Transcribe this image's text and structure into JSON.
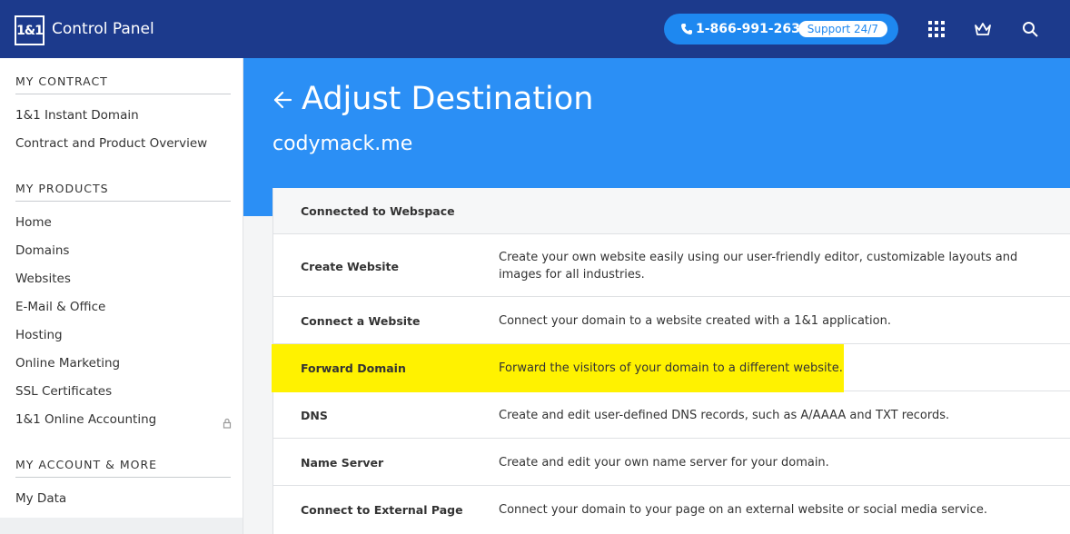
{
  "header": {
    "logo_text": "1&1",
    "app_title": "Control Panel",
    "phone": "1-866-991-2631",
    "support_label": "Support 24/7",
    "icons": [
      "phone-icon",
      "apps-grid-icon",
      "crown-icon",
      "search-icon"
    ]
  },
  "sidebar": {
    "sections": [
      {
        "title": "MY CONTRACT",
        "items": [
          "1&1 Instant Domain",
          "Contract and Product Overview"
        ]
      },
      {
        "title": "MY PRODUCTS",
        "items": [
          "Home",
          "Domains",
          "Websites",
          "E-Mail & Office",
          "Hosting",
          "Online Marketing",
          "SSL Certificates",
          "1&1 Online Accounting"
        ]
      },
      {
        "title": "MY ACCOUNT & MORE",
        "items": [
          "My Data"
        ]
      }
    ]
  },
  "page": {
    "title": "Adjust Destination",
    "subtitle": "codymack.me"
  },
  "destination_panel": {
    "header": "Connected to Webspace",
    "options": [
      {
        "label": "Create Website",
        "description": "Create your own website easily using our user-friendly editor, customizable layouts and images for all industries."
      },
      {
        "label": "Connect a Website",
        "description": "Connect your domain to a website created with a 1&1 application."
      },
      {
        "label": "Forward Domain",
        "description": "Forward the visitors of your domain to a different website.",
        "highlighted": true
      },
      {
        "label": "DNS",
        "description": "Create and edit user-defined DNS records, such as A/AAAA and TXT records."
      },
      {
        "label": "Name Server",
        "description": "Create and edit your own name server for your domain."
      },
      {
        "label": "Connect to External Page",
        "description": "Connect your domain to your page on an external website or social media service."
      }
    ]
  },
  "colors": {
    "header_bg": "#1c3a8c",
    "hero_bg": "#2b8ff5",
    "pill_bg": "#1e88f0",
    "highlight": "#fff200"
  }
}
